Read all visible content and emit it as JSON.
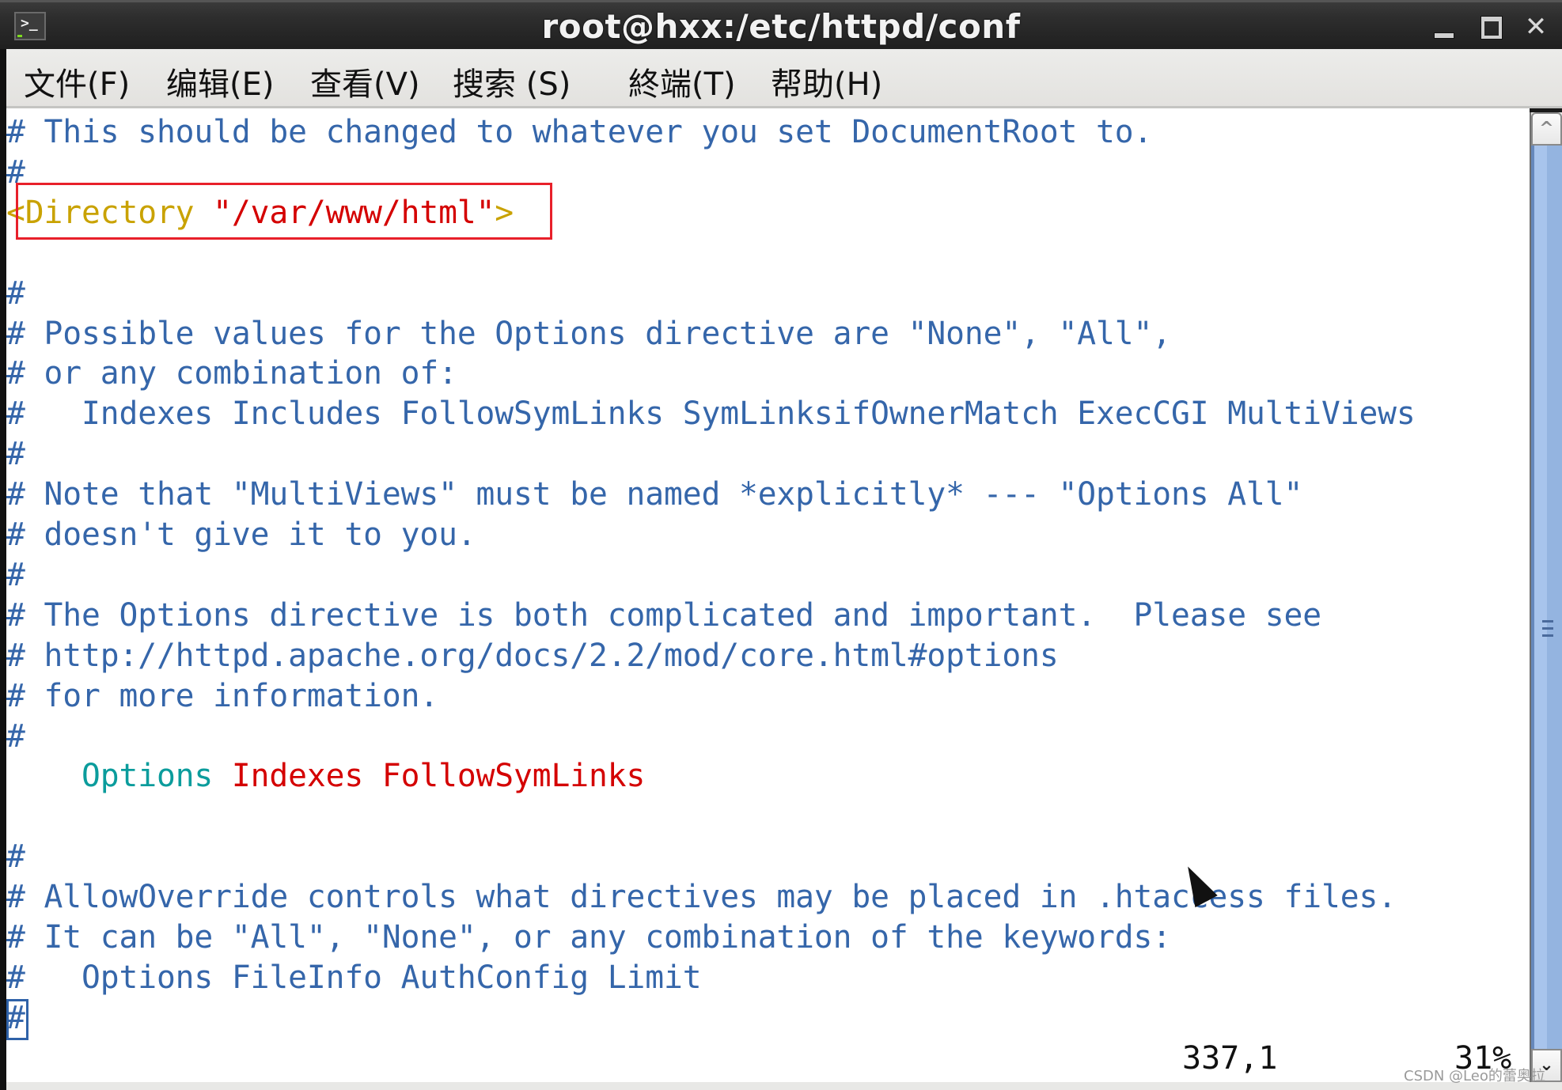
{
  "window": {
    "title": "root@hxx:/etc/httpd/conf",
    "icon": "terminal-icon",
    "controls": {
      "minimize": "minimize-icon",
      "maximize": "maximize-icon",
      "close": "close-icon",
      "close_glyph": "✕"
    }
  },
  "menubar": {
    "items": [
      {
        "label": "文件(F)"
      },
      {
        "label": "编辑(E)"
      },
      {
        "label": "查看(V)"
      },
      {
        "label": "搜索 (S)"
      },
      {
        "label": "終端(T)"
      },
      {
        "label": "帮助(H)"
      }
    ]
  },
  "editor": {
    "lines": [
      {
        "segments": [
          {
            "text": "# This should be changed to whatever you set DocumentRoot to.",
            "kind": "comment"
          }
        ]
      },
      {
        "segments": [
          {
            "text": "#",
            "kind": "comment"
          }
        ]
      },
      {
        "segments": [
          {
            "text": "<Directory ",
            "kind": "tag"
          },
          {
            "text": "\"/var/www/html\"",
            "kind": "str"
          },
          {
            "text": ">",
            "kind": "tag"
          }
        ]
      },
      {
        "segments": [
          {
            "text": "",
            "kind": "comment"
          }
        ]
      },
      {
        "segments": [
          {
            "text": "#",
            "kind": "comment"
          }
        ]
      },
      {
        "segments": [
          {
            "text": "# Possible values for the Options directive are \"None\", \"All\",",
            "kind": "comment"
          }
        ]
      },
      {
        "segments": [
          {
            "text": "# or any combination of:",
            "kind": "comment"
          }
        ]
      },
      {
        "segments": [
          {
            "text": "#   Indexes Includes FollowSymLinks SymLinksifOwnerMatch ExecCGI MultiViews",
            "kind": "comment"
          }
        ]
      },
      {
        "segments": [
          {
            "text": "#",
            "kind": "comment"
          }
        ]
      },
      {
        "segments": [
          {
            "text": "# Note that \"MultiViews\" must be named *explicitly* --- \"Options All\"",
            "kind": "comment"
          }
        ]
      },
      {
        "segments": [
          {
            "text": "# doesn't give it to you.",
            "kind": "comment"
          }
        ]
      },
      {
        "segments": [
          {
            "text": "#",
            "kind": "comment"
          }
        ]
      },
      {
        "segments": [
          {
            "text": "# The Options directive is both complicated and important.  Please see",
            "kind": "comment"
          }
        ]
      },
      {
        "segments": [
          {
            "text": "# http://httpd.apache.org/docs/2.2/mod/core.html#options",
            "kind": "comment"
          }
        ]
      },
      {
        "segments": [
          {
            "text": "# for more information.",
            "kind": "comment"
          }
        ]
      },
      {
        "segments": [
          {
            "text": "#",
            "kind": "comment"
          }
        ]
      },
      {
        "segments": [
          {
            "text": "    ",
            "kind": "comment"
          },
          {
            "text": "Options",
            "kind": "kw"
          },
          {
            "text": " Indexes FollowSymLinks",
            "kind": "val"
          }
        ]
      },
      {
        "segments": [
          {
            "text": "",
            "kind": "comment"
          }
        ]
      },
      {
        "segments": [
          {
            "text": "#",
            "kind": "comment"
          }
        ]
      },
      {
        "segments": [
          {
            "text": "# AllowOverride controls what directives may be placed in .htaccess files.",
            "kind": "comment"
          }
        ]
      },
      {
        "segments": [
          {
            "text": "# It can be \"All\", \"None\", or any combination of the keywords:",
            "kind": "comment"
          }
        ]
      },
      {
        "segments": [
          {
            "text": "#   Options FileInfo AuthConfig Limit",
            "kind": "comment"
          }
        ]
      },
      {
        "segments": [
          {
            "text": "#",
            "kind": "comment"
          }
        ]
      }
    ],
    "status": {
      "position": "337,1",
      "scroll_percent": "31%"
    }
  },
  "scrollbar": {
    "up_glyph": "^",
    "down_glyph": "⌄",
    "thumb_position": 0.31
  },
  "watermark": "CSDN @Leo的蕾奥拉",
  "colors": {
    "comment": "#3566aa",
    "tag": "#c9a200",
    "string": "#d40000",
    "keyword": "#0b9c9c",
    "highlight_box": "#e8202a"
  }
}
